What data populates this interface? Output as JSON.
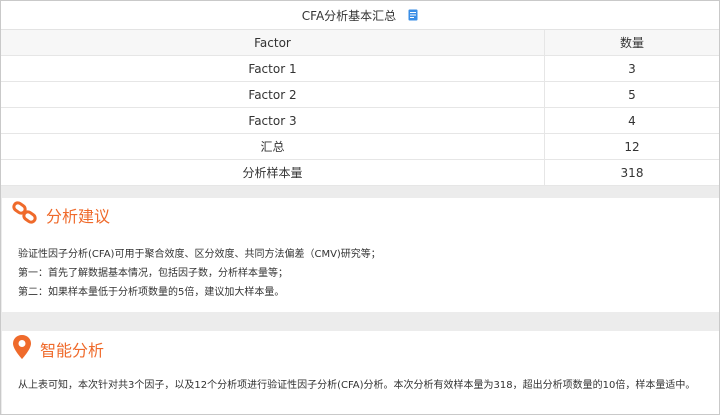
{
  "table": {
    "title": "CFA分析基本汇总",
    "icon": "document-icon",
    "headers": [
      "Factor",
      "数量"
    ],
    "rows": [
      [
        "Factor 1",
        "3"
      ],
      [
        "Factor 2",
        "5"
      ],
      [
        "Factor 3",
        "4"
      ],
      [
        "汇总",
        "12"
      ],
      [
        "分析样本量",
        "318"
      ]
    ]
  },
  "advice": {
    "icon": "chain-link-icon",
    "title": "分析建议",
    "lines": [
      "验证性因子分析(CFA)可用于聚合效度、区分效度、共同方法偏差（CMV)研究等；",
      "第一：首先了解数据基本情况，包括因子数，分析样本量等；",
      "第二：如果样本量低于分析项数量的5倍，建议加大样本量。"
    ]
  },
  "smart": {
    "icon": "location-pin-icon",
    "title": "智能分析",
    "text": "从上表可知，本次针对共3个因子，以及12个分析项进行验证性因子分析(CFA)分析。本次分析有效样本量为318，超出分析项数量的10倍，样本量适中。"
  },
  "colors": {
    "accent": "#ef6a2b",
    "doc_icon": "#3a8ee6"
  }
}
